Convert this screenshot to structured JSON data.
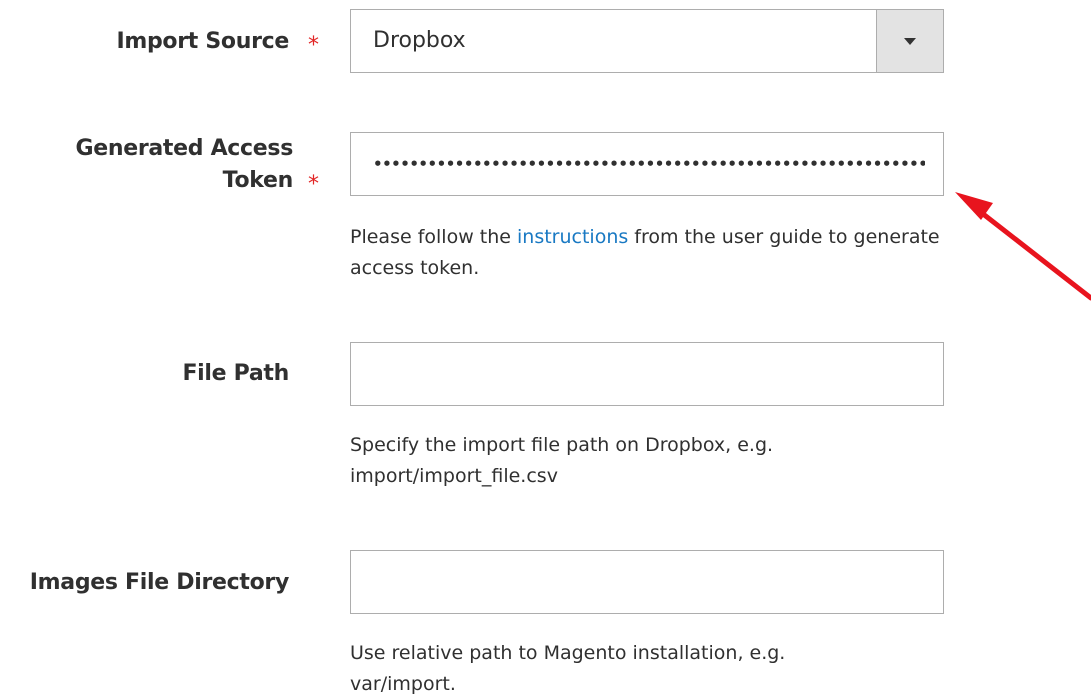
{
  "fields": {
    "import_source": {
      "label": "Import Source",
      "required_marker": "*",
      "value": "Dropbox"
    },
    "access_token": {
      "label_line1": "Generated Access",
      "label_line2": "Token",
      "required_marker": "*",
      "value": "••••••••••••••••••••••••••••••••••••••••••••••••••••••••••••••",
      "note_before": "Please follow the ",
      "note_link": "instructions",
      "note_after": " from the user guide to generate access token."
    },
    "file_path": {
      "label": "File Path",
      "value": "",
      "note_line1": "Specify the import file path on Dropbox, e.g.",
      "note_line2": "import/import_file.csv"
    },
    "images_dir": {
      "label": "Images File Directory",
      "value": "",
      "note_line1": "Use relative path to Magento installation, e.g.",
      "note_line2": "var/import."
    }
  },
  "annotation": {
    "arrow_color": "#e8141e"
  },
  "colors": {
    "required": "#e22626",
    "link": "#1979c3",
    "border": "#adadad",
    "select_button": "#e3e3e3"
  }
}
